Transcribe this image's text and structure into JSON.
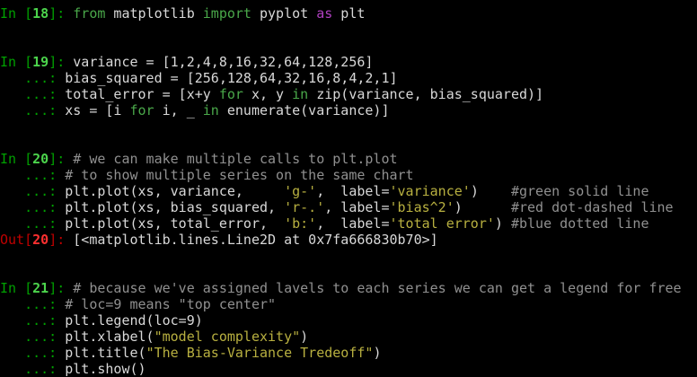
{
  "cells": [
    {
      "prompt": {
        "in": "In [",
        "num": "18",
        "close": "]: "
      },
      "lines": [
        [
          {
            "t": "from",
            "c": "kw"
          },
          {
            "t": " matplotlib ",
            "c": "yl"
          },
          {
            "t": "import",
            "c": "kw"
          },
          {
            "t": " pyplot ",
            "c": "yl"
          },
          {
            "t": "as",
            "c": "pur"
          },
          {
            "t": " plt",
            "c": "yl"
          }
        ]
      ]
    },
    {
      "prompt": {
        "in": "In [",
        "num": "19",
        "close": "]: "
      },
      "lines": [
        [
          {
            "t": "variance = [1,2,4,8,16,32,64,128,256]",
            "c": "yl"
          }
        ],
        [
          {
            "t": "bias_squared = [256,128,64,32,16,8,4,2,1]",
            "c": "yl"
          }
        ],
        [
          {
            "t": "total_error = [x+y ",
            "c": "yl"
          },
          {
            "t": "for",
            "c": "kw"
          },
          {
            "t": " x, y ",
            "c": "yl"
          },
          {
            "t": "in",
            "c": "kw"
          },
          {
            "t": " zip(variance, bias_squared)]",
            "c": "yl"
          }
        ],
        [
          {
            "t": "xs = [i ",
            "c": "yl"
          },
          {
            "t": "for",
            "c": "kw"
          },
          {
            "t": " i, _ ",
            "c": "yl"
          },
          {
            "t": "in",
            "c": "kw"
          },
          {
            "t": " enumerate(variance)]",
            "c": "yl"
          }
        ]
      ]
    },
    {
      "prompt": {
        "in": "In [",
        "num": "20",
        "close": "]: "
      },
      "lines": [
        [
          {
            "t": "# we can make multiple calls to plt.plot",
            "c": "cmt"
          }
        ],
        [
          {
            "t": "# to show multiple series on the same chart",
            "c": "cmt"
          }
        ],
        [
          {
            "t": "plt.plot(xs, variance,     ",
            "c": "yl"
          },
          {
            "t": "'g-'",
            "c": "str"
          },
          {
            "t": ",  label=",
            "c": "yl"
          },
          {
            "t": "'variance'",
            "c": "str"
          },
          {
            "t": ")    ",
            "c": "yl"
          },
          {
            "t": "#green solid line",
            "c": "cmt"
          }
        ],
        [
          {
            "t": "plt.plot(xs, bias_squared, ",
            "c": "yl"
          },
          {
            "t": "'r-.'",
            "c": "str"
          },
          {
            "t": ", label=",
            "c": "yl"
          },
          {
            "t": "'bias^2'",
            "c": "str"
          },
          {
            "t": ")      ",
            "c": "yl"
          },
          {
            "t": "#red dot-dashed line",
            "c": "cmt"
          }
        ],
        [
          {
            "t": "plt.plot(xs, total_error,  ",
            "c": "yl"
          },
          {
            "t": "'b:'",
            "c": "str"
          },
          {
            "t": ",  label=",
            "c": "yl"
          },
          {
            "t": "'total error'",
            "c": "str"
          },
          {
            "t": ") ",
            "c": "yl"
          },
          {
            "t": "#blue dotted line",
            "c": "cmt"
          }
        ]
      ],
      "output": {
        "out": "Out[",
        "num": "20",
        "close": "]: ",
        "text": "[<matplotlib.lines.Line2D at 0x7fa666830b70>]"
      }
    },
    {
      "prompt": {
        "in": "In [",
        "num": "21",
        "close": "]: "
      },
      "lines": [
        [
          {
            "t": "# because we've assigned lavels to each series we can get a legend for free",
            "c": "cmt"
          }
        ],
        [
          {
            "t": "# loc=9 means \"top center\"",
            "c": "cmt"
          }
        ],
        [
          {
            "t": "plt.legend(loc=9)",
            "c": "yl"
          }
        ],
        [
          {
            "t": "plt.xlabel(",
            "c": "yl"
          },
          {
            "t": "\"model complexity\"",
            "c": "str"
          },
          {
            "t": ")",
            "c": "yl"
          }
        ],
        [
          {
            "t": "plt.title(",
            "c": "yl"
          },
          {
            "t": "\"The Bias-Variance Tredeoff\"",
            "c": "str"
          },
          {
            "t": ")",
            "c": "yl"
          }
        ],
        [
          {
            "t": "plt.show()",
            "c": "yl"
          }
        ]
      ]
    }
  ],
  "continuation": "   ...: ",
  "colors": {
    "background": "#000000",
    "prompt_green": "#00a000",
    "prompt_num": "#4cd44c",
    "out_red": "#c00000",
    "keyword": "#4aa84a",
    "string": "#b8b040",
    "comment": "#909090",
    "text": "#d8d8d8"
  }
}
